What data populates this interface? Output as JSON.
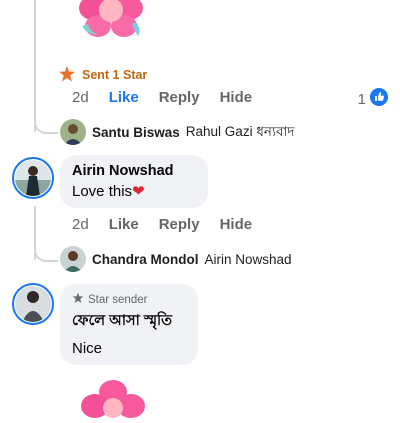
{
  "comment_top": {
    "badge_label": "Sent 1 Star",
    "time": "2d",
    "like_label": "Like",
    "reply_label": "Reply",
    "hide_label": "Hide",
    "reaction_count": "1",
    "reply_preview": {
      "name": "Santu Biswas",
      "text": "Rahul Gazi ধন্যবাদ"
    }
  },
  "comment_airin": {
    "author": "Airin Nowshad",
    "text": "Love this",
    "emoji": "❤️",
    "time": "2d",
    "like_label": "Like",
    "reply_label": "Reply",
    "hide_label": "Hide",
    "reply_preview": {
      "name": "Chandra Mondol",
      "text": "Airin Nowshad"
    }
  },
  "comment_third": {
    "badge_label": "Star sender",
    "author": "ফেলে আসা স্মৃতি",
    "text": "Nice"
  },
  "colors": {
    "like_blue": "#1877f2",
    "star_orange": "#e8722a",
    "bubble_bg": "#f0f2f5",
    "meta_gray": "#65676b"
  },
  "icons": {
    "sticker": "flower-sticker-icon",
    "star": "star-icon",
    "like": "like-thumb-icon"
  }
}
